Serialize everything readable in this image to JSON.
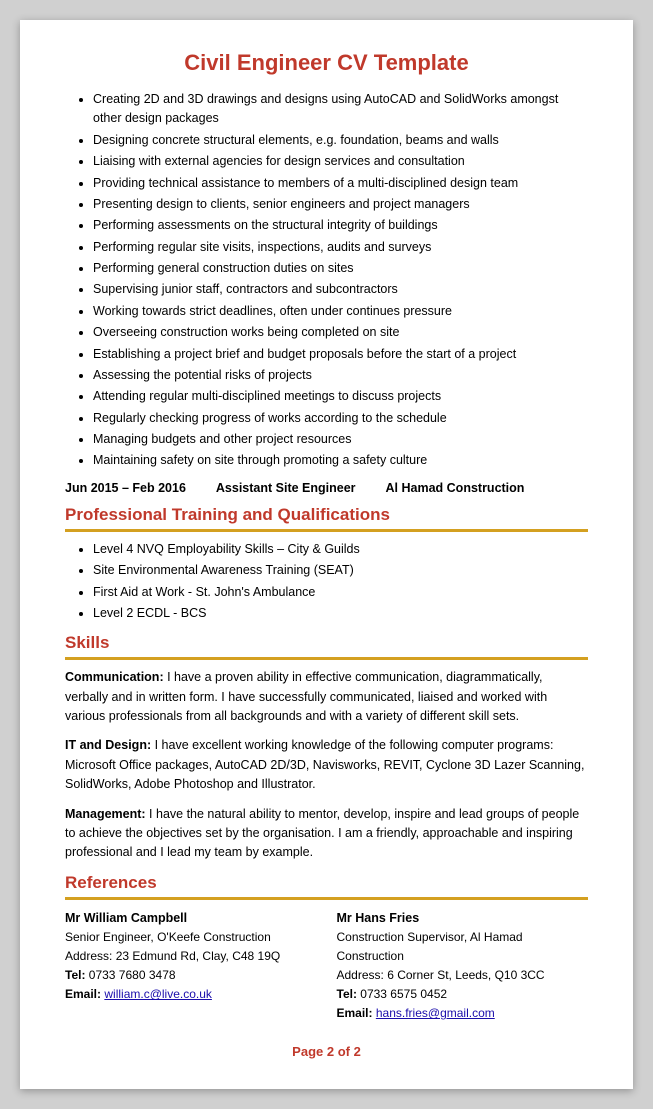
{
  "title": "Civil Engineer CV Template",
  "bullets": [
    "Creating 2D and 3D drawings and designs using AutoCAD and SolidWorks amongst other design packages",
    "Designing concrete structural elements, e.g. foundation, beams and walls",
    "Liaising with external agencies for design services and consultation",
    "Providing technical assistance to members of a multi-disciplined design team",
    "Presenting design to clients, senior engineers and project managers",
    "Performing assessments on the structural integrity of buildings",
    "Performing regular site visits, inspections, audits and surveys",
    "Performing general construction duties on sites",
    "Supervising junior staff, contractors and subcontractors",
    "Working towards strict deadlines, often under continues pressure",
    "Overseeing construction works being completed on site",
    "Establishing a project brief and budget proposals before the start of a project",
    "Assessing the potential risks of projects",
    "Attending regular multi-disciplined meetings to discuss projects",
    "Regularly checking progress of works according to the schedule",
    "Managing budgets and other project resources",
    "Maintaining safety on site through promoting a safety culture"
  ],
  "job": {
    "dates": "Jun 2015 – Feb 2016",
    "title": "Assistant Site Engineer",
    "company": "Al Hamad Construction"
  },
  "training_section": {
    "heading": "Professional Training and Qualifications",
    "items": [
      "Level 4 NVQ Employability Skills – City & Guilds",
      "Site Environmental Awareness Training (SEAT)",
      "First Aid at Work - St. John's Ambulance",
      "Level 2 ECDL - BCS"
    ]
  },
  "skills_section": {
    "heading": "Skills",
    "blocks": [
      {
        "label": "Communication:",
        "text": " I have a proven ability in effective communication, diagrammatically, verbally and in written form. I have successfully communicated, liaised and worked with various professionals from all backgrounds and with a variety of different skill sets."
      },
      {
        "label": "IT and Design:",
        "text": " I have excellent working knowledge of the following computer programs: Microsoft Office packages, AutoCAD 2D/3D, Navisworks, REVIT, Cyclone 3D Lazer Scanning, SolidWorks, Adobe Photoshop and Illustrator."
      },
      {
        "label": "Management:",
        "text": " I have the natural ability to mentor, develop, inspire and lead groups of people to achieve the objectives set by the organisation.  I am a friendly, approachable and inspiring professional and I lead my team by example."
      }
    ]
  },
  "references_section": {
    "heading": "References",
    "refs": [
      {
        "name": "Mr William Campbell",
        "title": "Senior Engineer, O'Keefe Construction",
        "address": "Address: 23 Edmund Rd, Clay, C48 19Q",
        "tel_label": "Tel:",
        "tel": "0733 7680 3478",
        "email_label": "Email:",
        "email": "william.c@live.co.uk"
      },
      {
        "name": "Mr Hans Fries",
        "title": "Construction Supervisor, Al Hamad Construction",
        "address": "Address: 6 Corner St, Leeds, Q10 3CC",
        "tel_label": "Tel:",
        "tel": "0733 6575 0452",
        "email_label": "Email:",
        "email": "hans.fries@gmail.com"
      }
    ]
  },
  "page_number": "Page 2 of 2"
}
